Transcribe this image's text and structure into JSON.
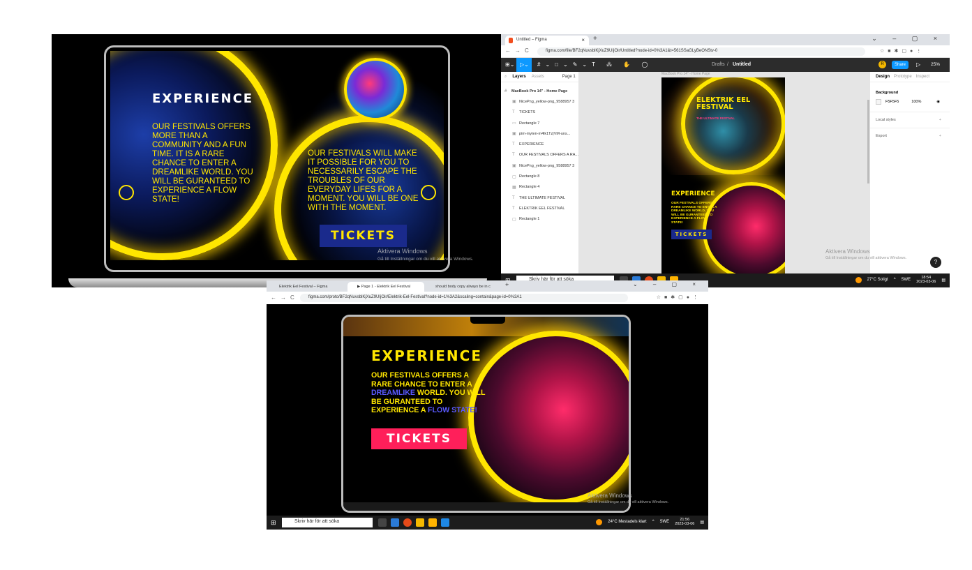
{
  "panel1": {
    "title": "EXPERIENCE",
    "left_text": "OUR FESTIVALS OFFERS MORE THAN A COMMUNITY AND A FUN TIME. IT IS A RARE CHANCE TO ENTER A DREAMLIKE WORLD. YOU WILL BE GURANTEED TO EXPERIENCE A FLOW STATE!",
    "right_text": "OUR FESTIVALS WILL MAKE IT POSSIBLE FOR YOU TO NECESSARILY ESCAPE THE TROUBLES OF OUR EVERYDAY LIFES FOR A MOMENT. YOU WILL BE ONE WITH THE MOMENT.",
    "tickets": "TICKETS",
    "watermark_title": "Aktivera Windows",
    "watermark_sub": "Gå till Inställningar om du vill aktivera Windows."
  },
  "panel2": {
    "tab_title": "Untitled – Figma",
    "url": "figma.com/file/BF2qNuvsblKjXuZ9UIjOir/Untitled?node-id=0%3A1&t=561SSaGLyBeONStv-0",
    "breadcrumb_drafts": "Drafts",
    "breadcrumb_sep": "/",
    "breadcrumb_file": "Untitled",
    "share": "Share",
    "zoom": "25%",
    "avatar": "R",
    "tabs": {
      "layers": "Layers",
      "assets": "Assets",
      "page": "Page 1"
    },
    "frame_label": "MacBook Pro 14\" - Home Page",
    "canvas_label": "MacBook Pro 14\" - Home Page",
    "layers": [
      "NicePng_yellow-png_9588957 3",
      "TICKETS",
      "Rectangle 7",
      "pim-myten-m4lk1Tz|VM-uns...",
      "EXPERIENCE",
      "OUR FESTIVALS OFFERS A RA...",
      "NicePng_yellow-png_9588957 3",
      "Rectangle 8",
      "Rectangle 4",
      "THE ULTIMATE FESTIVAL",
      "ELEKTRIK EEL FESTIVAL",
      "Rectangle 1"
    ],
    "right_tabs": {
      "design": "Design",
      "prototype": "Prototype",
      "inspect": "Inspect"
    },
    "background_label": "Background",
    "bg_hex": "F5F5F5",
    "bg_opacity": "100%",
    "local_styles": "Local styles",
    "export": "Export",
    "art_title": "ELEKTRIK EEL FESTIVAL",
    "art_subtitle": "THE ULTIMATE FESTIVAL",
    "art_exp": "EXPERIENCE",
    "art_text": "OUR FESTIVALS OFFERS A RARE CHANCE TO ENTER A DREAMLIKE WORLD. YOU WILL BE GURANTEED TO EXPERIENCE A FLOW STATE!",
    "art_tickets": "TICKETS",
    "watermark_title": "Aktivera Windows",
    "watermark_sub": "Gå till Inställningar om du vill aktivera Windows.",
    "help": "?",
    "taskbar": {
      "search_placeholder": "Skriv här för att söka",
      "weather": "27°C Soligt",
      "lang": "SWE",
      "time": "18:54",
      "date": "2023-03-06"
    }
  },
  "panel3": {
    "tabs": [
      "Elektrik Eel Festival – Figma",
      "▶ Page 1 - Elektrik Eel Festival",
      "should body copy always be in c"
    ],
    "url": "figma.com/proto/BF2qNuvsblKjXuZ9UIjOir/Elektrik-Eel-Festival?node-id=1%3A2&scaling=contain&page-id=0%3A1",
    "title": "EXPERIENCE",
    "line1": "OUR FESTIVALS OFFERS A",
    "line2": "RARE CHANCE TO ENTER A",
    "dreamlike": "DREAMLIKE",
    "line3_rest": " WORLD. YOU WILL",
    "line4": "BE GURANTEED TO",
    "line5": "EXPERIENCE A ",
    "flow_state": "FLOW STATE!",
    "tickets": "TICKETS",
    "watermark_title": "Aktivera Windows",
    "watermark_sub": "Gå till Inställningar om du vill aktivera Windows.",
    "taskbar": {
      "search_placeholder": "Skriv här för att söka",
      "weather": "24°C Mestadels klart",
      "lang": "SWE",
      "time": "21:56",
      "date": "2023-03-06"
    }
  },
  "colors": {
    "neon_yellow": "#ffe600",
    "ticket_blue": "#1a2a8c",
    "ticket_pink": "#ff1f5a",
    "figma_blue": "#0d99ff"
  }
}
